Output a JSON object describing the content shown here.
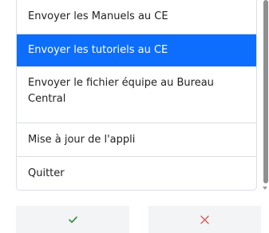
{
  "menu": {
    "items": [
      {
        "label": "Envoyer les Manuels au CE"
      },
      {
        "label": "Envoyer les tutoriels au CE",
        "selected": true
      },
      {
        "label": "Envoyer le fichier équipe au Bureau Central"
      },
      {
        "label": "Mise à jour de l'appli"
      },
      {
        "label": "Quitter"
      }
    ]
  },
  "actions": {
    "confirm_icon": "check-icon",
    "cancel_icon": "close-icon"
  },
  "colors": {
    "selected_bg": "#0d6efd",
    "confirm_icon_color": "#2e8b3a",
    "cancel_icon_color": "#d9534f"
  }
}
